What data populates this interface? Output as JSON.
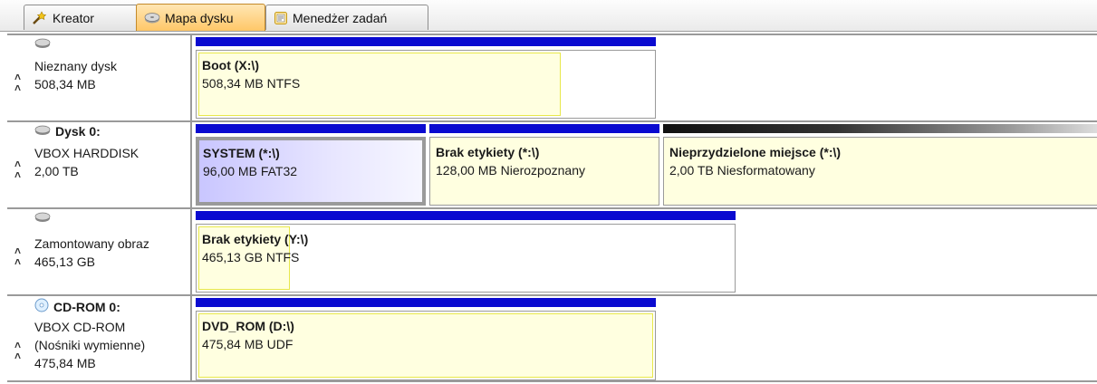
{
  "tabs": [
    {
      "label": "Kreator",
      "icon": "wizard-icon"
    },
    {
      "label": "Mapa dysku",
      "icon": "disk-icon",
      "active": true
    },
    {
      "label": "Menedżer zadań",
      "icon": "task-manager-icon"
    }
  ],
  "disks": [
    {
      "title": "",
      "lines": [
        "Nieznany dysk",
        "508,34 MB"
      ],
      "volumes": [
        {
          "name": "Boot (X:\\)",
          "info": "508,34 MB NTFS",
          "used_fraction": 0.79
        }
      ]
    },
    {
      "title": "Dysk 0:",
      "lines": [
        "VBOX HARDDISK",
        "2,00 TB"
      ],
      "volumes": [
        {
          "name": "SYSTEM (*:\\)",
          "info": "96,00 MB FAT32",
          "selected": true
        },
        {
          "name": "Brak etykiety (*:\\)",
          "info": "128,00 MB Nierozpoznany"
        },
        {
          "name": "Nieprzydzielone miejsce (*:\\)",
          "info": "2,00 TB Niesformatowany"
        }
      ]
    },
    {
      "title": "",
      "lines": [
        "Zamontowany obraz",
        "465,13 GB"
      ],
      "volumes": [
        {
          "name": "Brak etykiety (Y:\\)",
          "info": "465,13 GB NTFS",
          "used_fraction": 0.17
        }
      ]
    },
    {
      "title": "CD-ROM 0:",
      "lines": [
        "VBOX CD-ROM",
        "(Nośniki wymienne)",
        "475,84 MB"
      ],
      "volumes": [
        {
          "name": "DVD_ROM (D:\\)",
          "info": "475,84 MB UDF",
          "used_fraction": 1.0
        }
      ]
    }
  ],
  "colors": {
    "partition_bar": "#0a0ad0",
    "unallocated_bar": "#202020",
    "used_fill": "#ffffe0",
    "active_tab": "#ffc768"
  }
}
